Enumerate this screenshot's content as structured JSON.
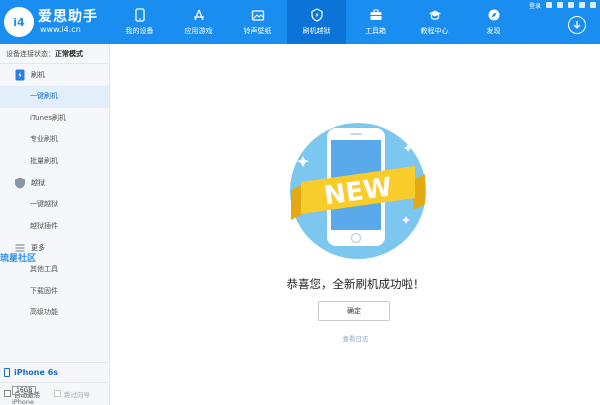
{
  "app": {
    "brand": "爱思助手",
    "url": "www.i4.cn",
    "logo_text": "i4"
  },
  "topbar": {
    "login": "登录",
    "nav": [
      {
        "label": "我的设备",
        "icon": "apple-icon"
      },
      {
        "label": "应用游戏",
        "icon": "app-store-icon"
      },
      {
        "label": "铃声壁纸",
        "icon": "ringtone-wallpaper-icon"
      },
      {
        "label": "刷机越狱",
        "icon": "flash-jailbreak-icon"
      },
      {
        "label": "工具箱",
        "icon": "toolbox-icon"
      },
      {
        "label": "教程中心",
        "icon": "graduation-cap-icon"
      },
      {
        "label": "发现",
        "icon": "compass-icon"
      }
    ],
    "active_index": 3
  },
  "sidebar": {
    "status_label": "设备连接状态：",
    "status_value": "正常模式",
    "groups": [
      {
        "label": "刷机",
        "icon": "flash-icon",
        "items": [
          "一键刷机",
          "iTunes刷机",
          "专业刷机",
          "批量刷机"
        ]
      },
      {
        "label": "越狱",
        "icon": "shield-icon",
        "items": [
          "一键越狱",
          "越狱插件"
        ]
      },
      {
        "label": "更多",
        "icon": "menu-icon",
        "items": [
          "其他工具",
          "下载固件",
          "高级功能"
        ]
      }
    ],
    "active_item": "一键刷机",
    "watermark": "琉星社区",
    "auto_activate": "自动激活",
    "skip_guide": "跳过向导"
  },
  "device": {
    "name": "iPhone 6s",
    "capacity": "16GB",
    "model": "iPhone"
  },
  "main": {
    "badge_text": "NEW",
    "message": "恭喜您，全新刷机成功啦！",
    "ok_label": "确定",
    "log_link": "查看日志"
  },
  "colors": {
    "accent": "#1a8df0",
    "accent_dark": "#0b74d6",
    "badge": "#f8cc2a"
  }
}
